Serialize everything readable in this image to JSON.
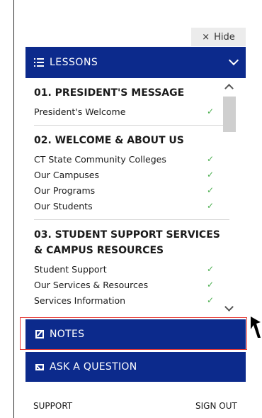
{
  "hide_button": {
    "label": "Hide",
    "icon": "close-icon"
  },
  "lessons_header": {
    "label": "LESSONS"
  },
  "sections": [
    {
      "title": "01. PRESIDENT'S MESSAGE",
      "items": [
        {
          "label": "President's Welcome",
          "complete": true
        }
      ]
    },
    {
      "title": "02. WELCOME & ABOUT US",
      "items": [
        {
          "label": "CT State Community Colleges",
          "complete": true
        },
        {
          "label": "Our Campuses",
          "complete": true
        },
        {
          "label": "Our Programs",
          "complete": true
        },
        {
          "label": "Our Students",
          "complete": true
        }
      ]
    },
    {
      "title": "03. STUDENT SUPPORT SERVICES & CAMPUS RESOURCES",
      "items": [
        {
          "label": "Student Support",
          "complete": true
        },
        {
          "label": "Our Services & Resources",
          "complete": true
        },
        {
          "label": "Services Information",
          "complete": true
        }
      ]
    }
  ],
  "notes_button": {
    "label": "NOTES"
  },
  "ask_button": {
    "label": "ASK A QUESTION"
  },
  "footer": {
    "support": "SUPPORT",
    "sign_out": "SIGN OUT"
  },
  "colors": {
    "primary": "#0c2a8c",
    "check": "#4caf50",
    "highlight": "#e53935"
  }
}
